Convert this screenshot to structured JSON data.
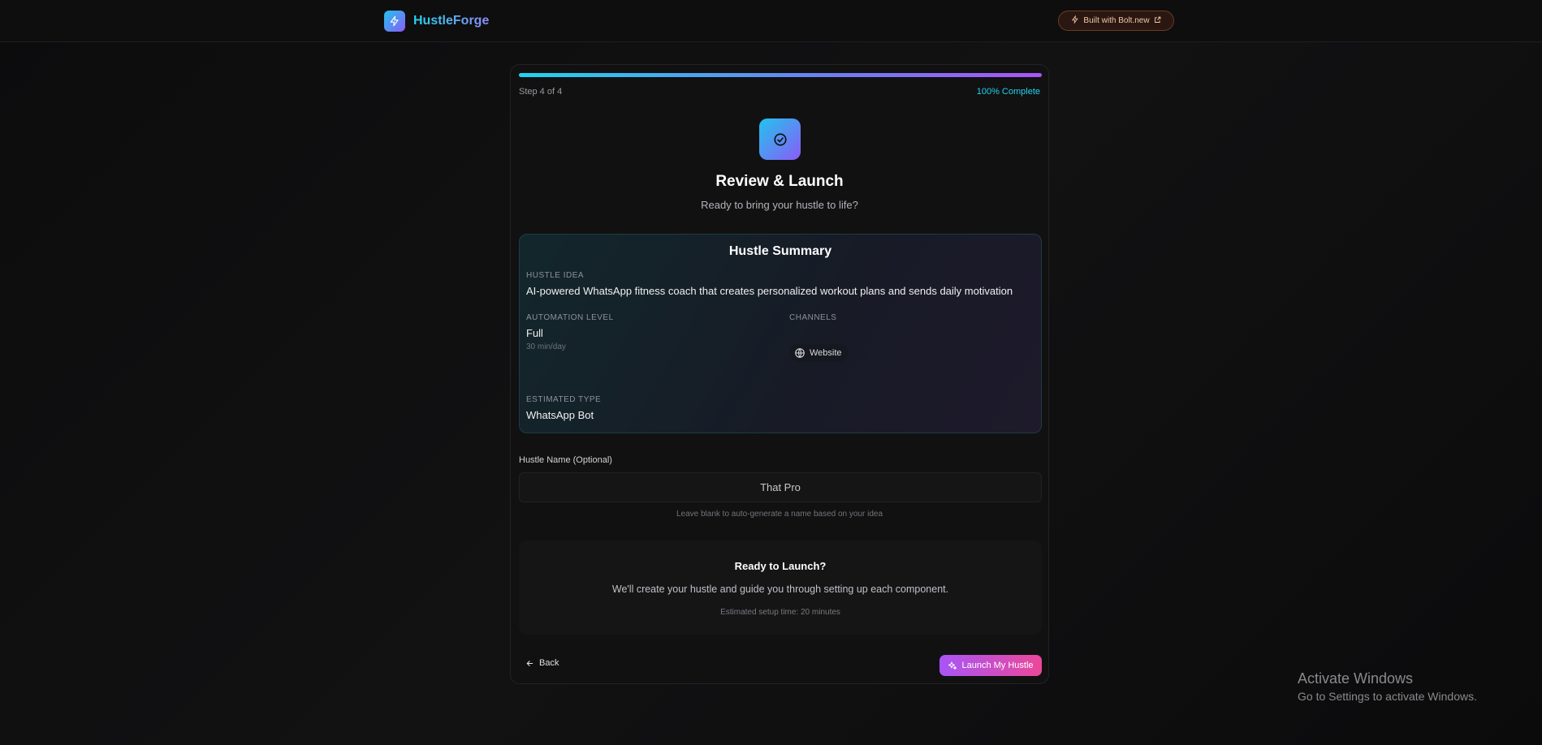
{
  "header": {
    "brand": "HustleForge",
    "logo_icon": "bolt-icon",
    "badge_label": "Built with Bolt.new"
  },
  "progress": {
    "step_label": "Step 4 of 4",
    "percent_label": "100% Complete",
    "fraction": 1.0
  },
  "hero": {
    "icon": "check-circle-icon",
    "title": "Review & Launch",
    "subtitle": "Ready to bring your hustle to life?"
  },
  "summary": {
    "title": "Hustle Summary",
    "idea_label": "HUSTLE IDEA",
    "idea_value": "AI-powered WhatsApp fitness coach that creates personalized workout plans and sends daily motivation",
    "automation_label": "AUTOMATION LEVEL",
    "automation_value": "Full",
    "automation_time": "30 min/day",
    "channels_label": "CHANNELS",
    "channels": [
      "Website"
    ],
    "type_label": "ESTIMATED TYPE",
    "type_value": "WhatsApp Bot"
  },
  "name_field": {
    "label": "Hustle Name (Optional)",
    "value": "That Pro",
    "help": "Leave blank to auto-generate a name based on your idea"
  },
  "ready": {
    "title": "Ready to Launch?",
    "body": "We'll create your hustle and guide you through setting up each component.",
    "time": "Estimated setup time: 20 minutes"
  },
  "actions": {
    "back_label": "Back",
    "launch_label": "Launch My Hustle"
  },
  "watermark": {
    "line1": "Activate Windows",
    "line2": "Go to Settings to activate Windows."
  },
  "colors": {
    "accent_cyan": "#22d3ee",
    "accent_purple": "#8b5cf6",
    "accent_pink": "#ec4899",
    "background": "#0e0e0f"
  }
}
